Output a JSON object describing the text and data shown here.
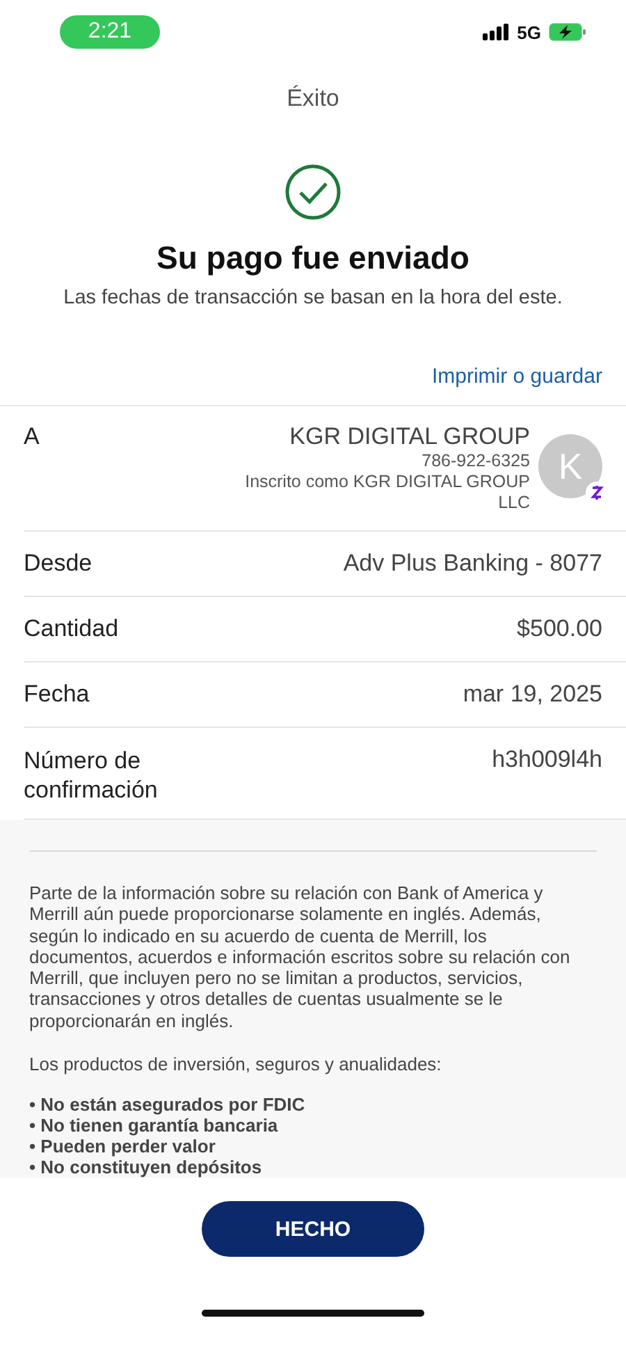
{
  "status_bar": {
    "time": "2:21",
    "network": "5G"
  },
  "header": {
    "title": "Éxito"
  },
  "confirmation": {
    "heading": "Su pago fue enviado",
    "subtitle": "Las fechas de transacción se basan en la hora del este.",
    "print_link": "Imprimir o guardar"
  },
  "recipient": {
    "label": "A",
    "name": "KGR DIGITAL GROUP",
    "phone": "786-922-6325",
    "enrolled_as": "Inscrito como KGR DIGITAL GROUP LLC",
    "avatar_initial": "K"
  },
  "details": [
    {
      "label": "Desde",
      "value": "Adv Plus Banking - 8077"
    },
    {
      "label": "Cantidad",
      "value": "$500.00"
    },
    {
      "label": "Fecha",
      "value": "mar 19, 2025"
    },
    {
      "label": "Número de confirmación",
      "value": "h3h009l4h"
    }
  ],
  "disclosure": {
    "paragraph": "Parte de la información sobre su relación con Bank of America y Merrill aún puede proporcionarse solamente en inglés. Además, según lo indicado en su acuerdo de cuenta de Merrill, los documentos, acuerdos e información escritos sobre su relación con Merrill, que incluyen pero no se limitan a productos, servicios, transacciones y otros detalles de cuentas usualmente se le proporcionarán en inglés.",
    "intro": "Los productos de inversión, seguros y anualidades:",
    "bullets": [
      "• No están asegurados por FDIC",
      "• No tienen garantía bancaria",
      "• Pueden perder valor",
      "• No constituyen depósitos"
    ]
  },
  "done_button": "HECHO"
}
